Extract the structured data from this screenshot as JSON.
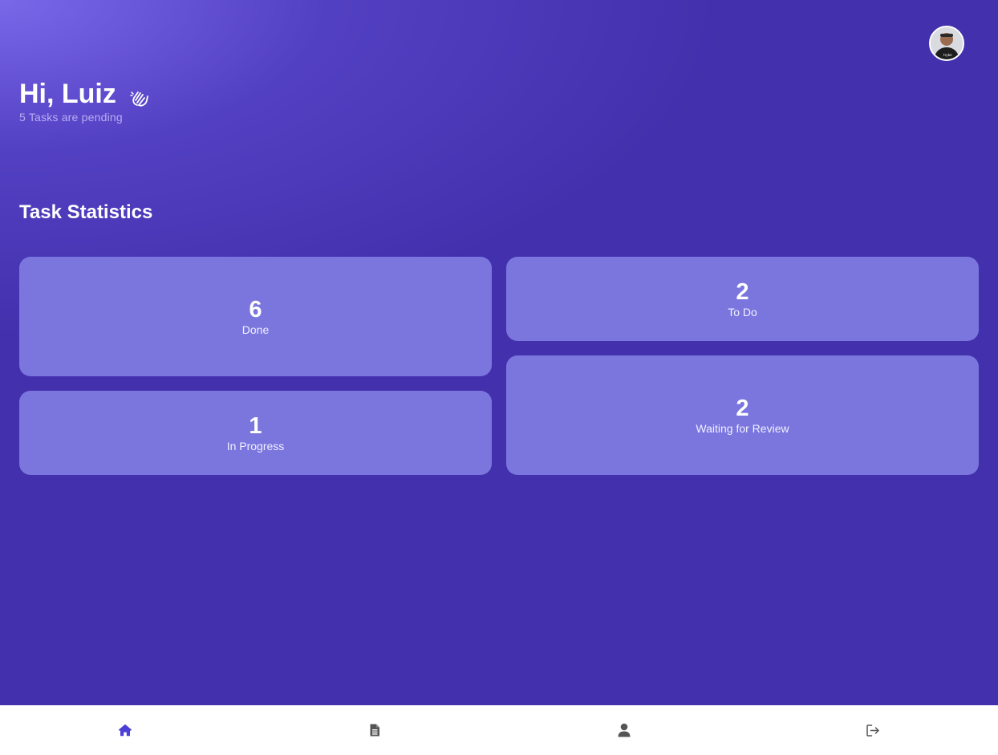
{
  "header": {
    "greeting": "Hi, Luiz",
    "greeting_icon": "wave-hand-icon",
    "pending_text": "5 Tasks are pending",
    "avatar_icon": "user-avatar"
  },
  "stats": {
    "title": "Task Statistics",
    "cards": [
      {
        "value": "6",
        "label": "Done"
      },
      {
        "value": "1",
        "label": "In Progress"
      },
      {
        "value": "2",
        "label": "To Do"
      },
      {
        "value": "2",
        "label": "Waiting for Review"
      }
    ]
  },
  "nav": {
    "items": [
      {
        "icon": "home-icon",
        "active": true
      },
      {
        "icon": "document-icon",
        "active": false
      },
      {
        "icon": "user-icon",
        "active": false
      },
      {
        "icon": "logout-icon",
        "active": false
      }
    ]
  },
  "colors": {
    "background": "#4230ad",
    "card": "#7a76de",
    "nav_active": "#4b3fd6",
    "nav_inactive": "#555555"
  }
}
